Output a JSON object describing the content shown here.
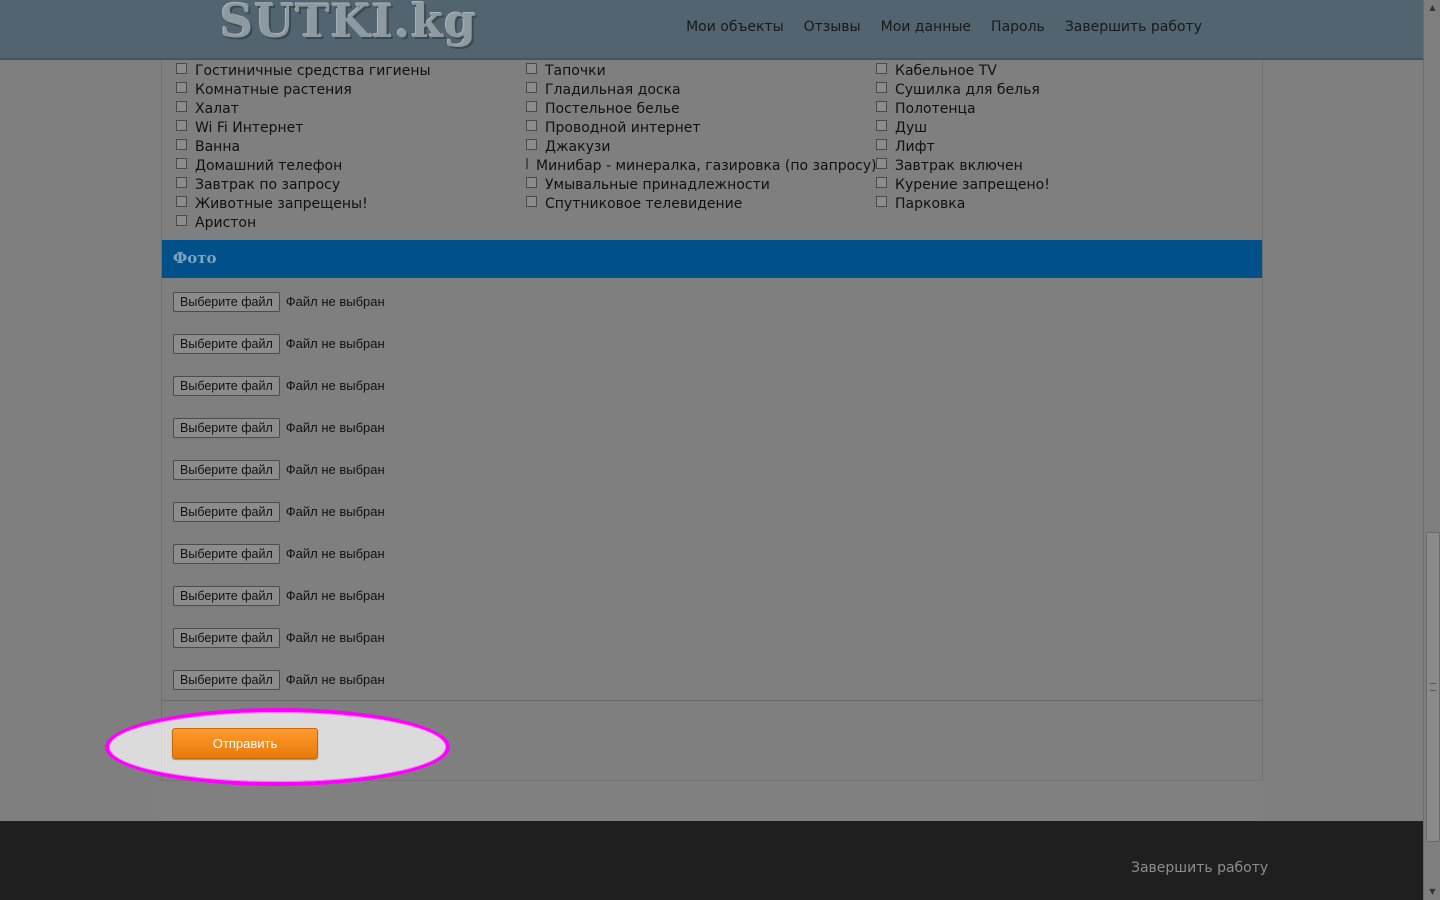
{
  "header": {
    "logo": "SUTKI.kg",
    "nav": [
      "Мои объекты",
      "Отзывы",
      "Мои данные",
      "Пароль",
      "Завершить работу"
    ]
  },
  "amenities": {
    "col1": [
      "Гостиничные средства гигиены",
      "Комнатные растения",
      "Халат",
      "Wi Fi Интернет",
      "Ванна",
      "Домашний телефон",
      "Завтрак по запросу",
      "Животные запрещены!",
      "Аристон"
    ],
    "col2": [
      "Тапочки",
      "Гладильная доска",
      "Постельное белье",
      "Проводной интернет",
      "Джакузи",
      "Минибар - минералка, газировка (по запросу)",
      "Умывальные принадлежности",
      "Спутниковое телевидение"
    ],
    "col3": [
      "Кабельное TV",
      "Сушилка для белья",
      "Полотенца",
      "Душ",
      "Лифт",
      "Завтрак включен",
      "Курение запрещено!",
      "Парковка"
    ]
  },
  "photo_section": {
    "title": "Фото",
    "file_button_label": "Выберите файл",
    "file_status": "Файл не выбран",
    "count": 10
  },
  "submit_label": "Отправить",
  "footer": {
    "logout": "Завершить работу"
  },
  "colors": {
    "section_header": "#00518a",
    "submit": "#ff8c1a",
    "highlight": "#ff00ff",
    "footer": "#1f1f1f"
  }
}
